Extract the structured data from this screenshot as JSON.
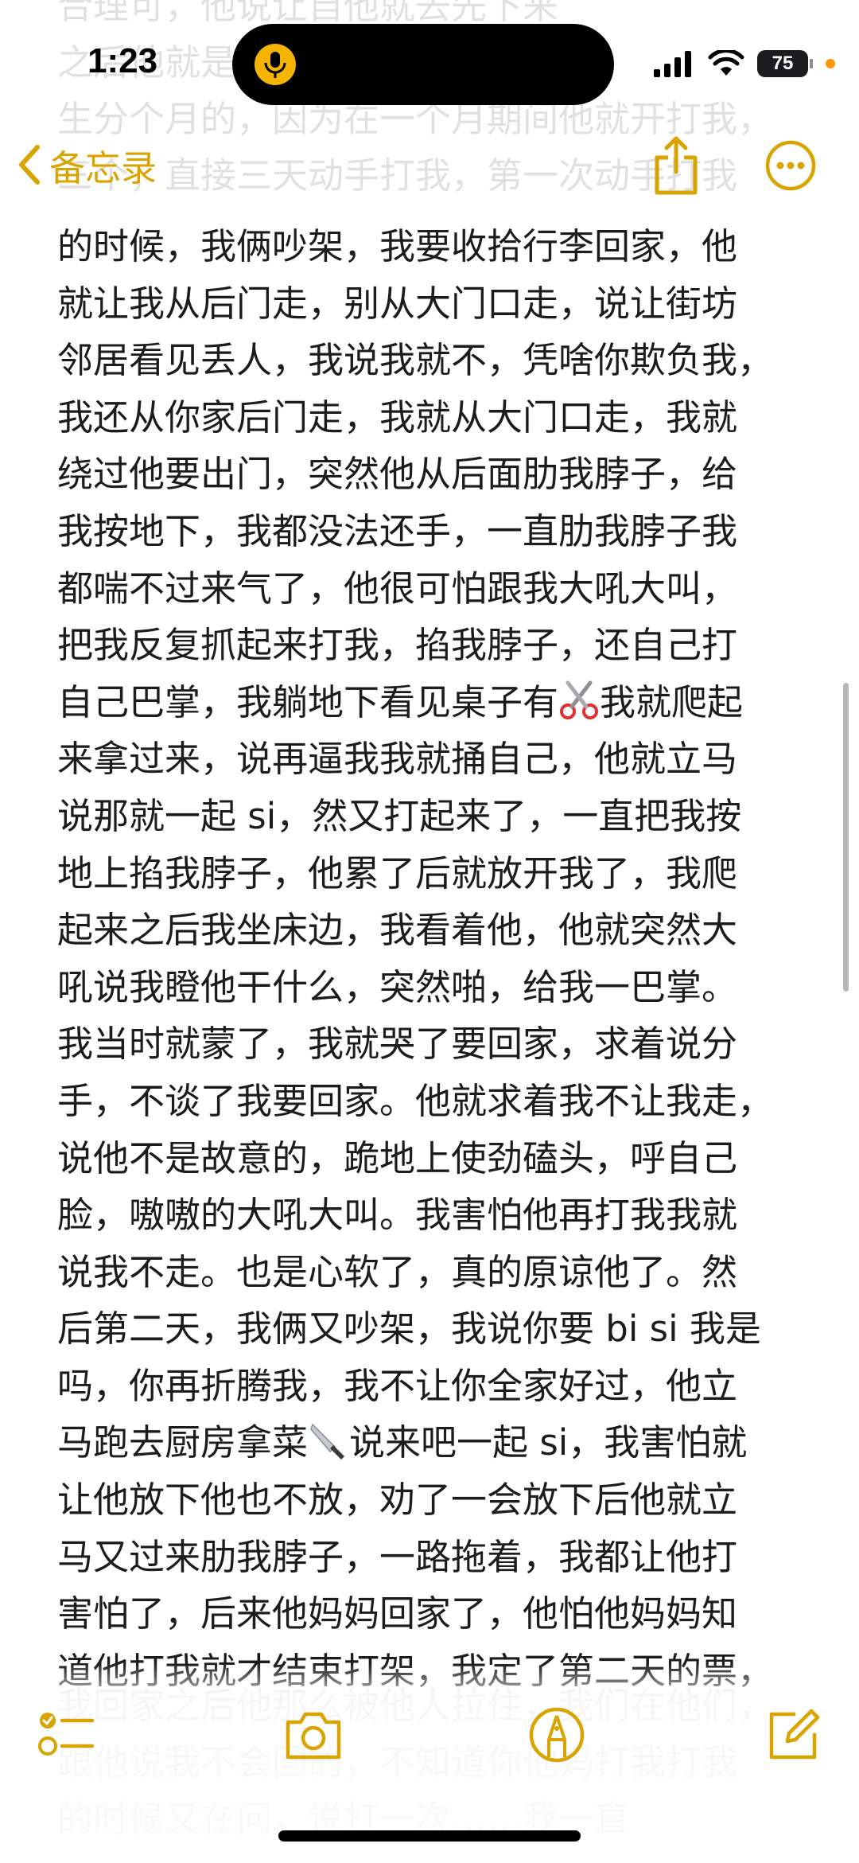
{
  "status_bar": {
    "time": "1:23",
    "battery": "75",
    "battery_level": 0.75
  },
  "nav": {
    "back_label": "备忘录"
  },
  "ghost_text": {
    "top_lines": [
      "合理可，他说让自他就去先下来",
      "之后他就是，我说让他妈他妈……",
      "生分个月的，因为在一个月期间他就开打我，",
      "三个，直接三天动手打我，第一次动手打我"
    ],
    "bottom_lines": [
      "我回家之后他那么被他人拉住，我们在他们，",
      "跟他说我不会回的，不知道你他妈打我打我",
      "的时候又在问，说打一次……我一直"
    ]
  },
  "note": {
    "lines": [
      "的时候，我俩吵架，我要收拾行李回家，他",
      "就让我从后门走，别从大门口走，说让街坊",
      "邻居看见丢人，我说我就不，凭啥你欺负我，",
      "我还从你家后门走，我就从大门口走，我就",
      "绕过他要出门，突然他从后面肋我脖子，给",
      "我按地下，我都没法还手，一直肋我脖子我",
      "都喘不过来气了，他很可怕跟我大吼大叫，",
      "把我反复抓起来打我，掐我脖子，还自己打",
      "自己巴掌，我躺地下看见桌子有",
      "来拿过来，说再逼我我就捅自己，他就立马",
      "说那就一起 si，然又打起来了，一直把我按",
      "地上掐我脖子，他累了后就放开我了，我爬",
      "起来之后我坐床边，我看着他，他就突然大",
      "吼说我瞪他干什么，突然啪，给我一巴掌。",
      "我当时就蒙了，我就哭了要回家，求着说分",
      "手，不谈了我要回家。他就求着我不让我走，",
      "说他不是故意的，跪地上使劲磕头，呼自己",
      "脸，嗷嗷的大吼大叫。我害怕他再打我我就",
      "说我不走。也是心软了，真的原谅他了。然",
      "后第二天，我俩又吵架，我说你要 bi si 我是",
      "吗，你再折腾我，我不让你全家好过，他立",
      "马跑去厨房拿菜",
      "让他放下他也不放，劝了一会放下后他就立",
      "马又过来肋我脖子，一路拖着，我都让他打",
      "害怕了，后来他妈妈回家了，他怕他妈妈知",
      "道他打我就才结束打架，我定了第二天的票，"
    ],
    "line9_tail": "我就爬起",
    "line22_tail": "说来吧一起 si，我害怕就"
  },
  "toolbar": {
    "items": [
      "checklist-icon",
      "camera-icon",
      "markup-pen-icon",
      "compose-icon"
    ]
  },
  "colors": {
    "accent": "#d9a400",
    "text": "#1c1c1e"
  }
}
